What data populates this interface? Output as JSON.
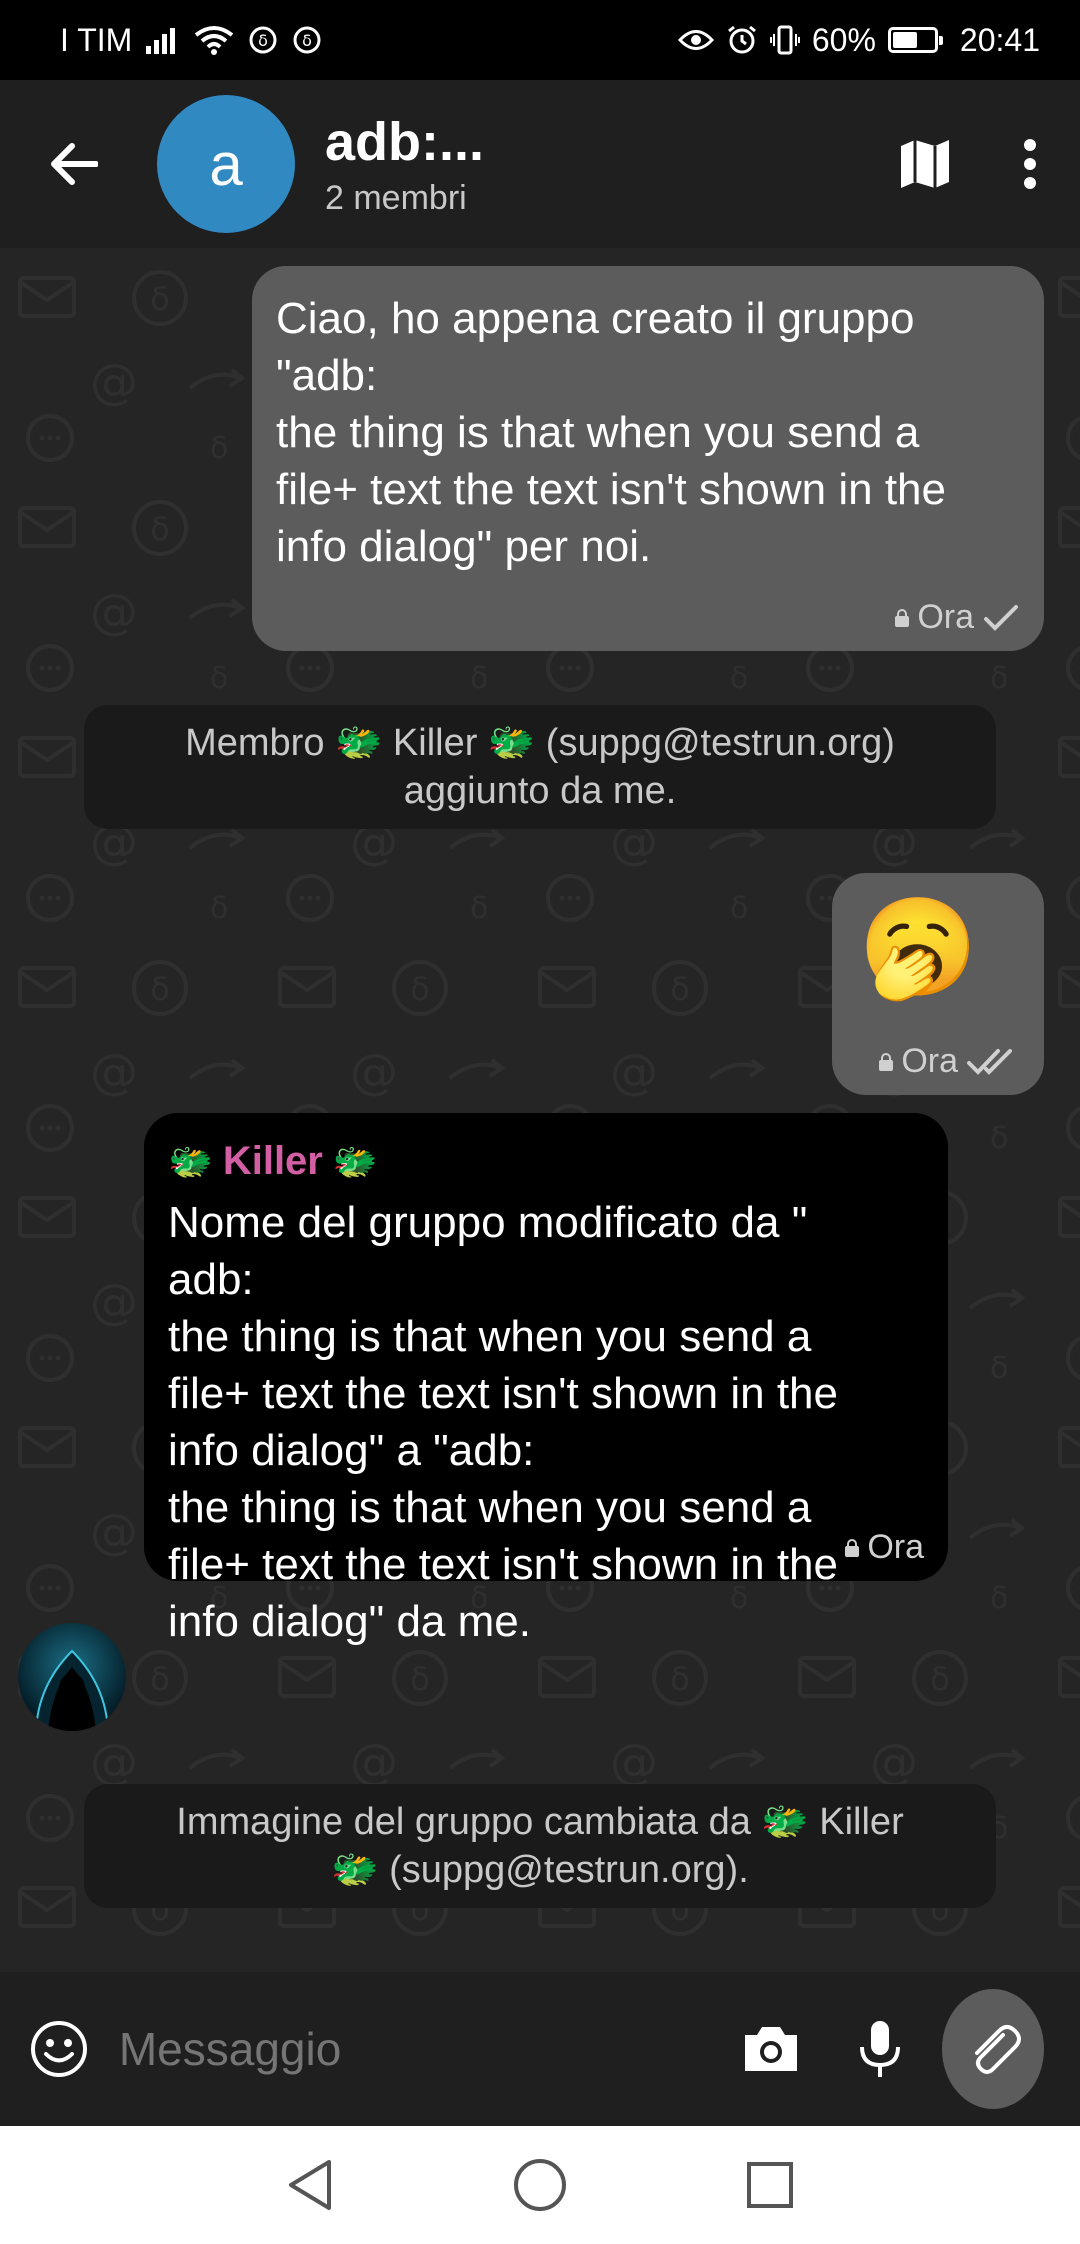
{
  "status_bar": {
    "carrier": "I TIM",
    "battery": "60%",
    "battery_level": 0.6,
    "time": "20:41"
  },
  "header": {
    "avatar_letter": "a",
    "title": "adb:...",
    "subtitle": "2 membri"
  },
  "messages": {
    "m1": {
      "text": "Ciao, ho appena creato il gruppo\n\"adb:\nthe thing is that when you send a\nfile+ text the text isn't shown in the\ninfo dialog\" per noi.",
      "time": "Ora"
    },
    "s1": {
      "text": "Membro 🐲 Killer 🐲 (suppg@testrun.org)\naggiunto da me."
    },
    "m2": {
      "emoji": "🥱",
      "time": "Ora"
    },
    "m3": {
      "sender": "Killer",
      "sender_emoji": "🐲",
      "text": "Nome del gruppo modificato da \"\nadb:\nthe thing is that when you send a\nfile+ text the text isn't shown in the\ninfo dialog\" a \"adb:\nthe thing is that when you send a\nfile+ text the text isn't shown in the\ninfo dialog\" da me.",
      "time": "Ora"
    },
    "s2": {
      "text": "Immagine del gruppo cambiata da 🐲 Killer\n🐲 (suppg@testrun.org)."
    }
  },
  "composer": {
    "placeholder": "Messaggio"
  },
  "colors": {
    "header_bg": "#1f1f1f",
    "chat_bg": "#252525",
    "outgoing_bubble": "#5c5c5c",
    "incoming_bubble": "#000000",
    "avatar_blue": "#3189c2",
    "sender_name": "#d25fa3"
  }
}
